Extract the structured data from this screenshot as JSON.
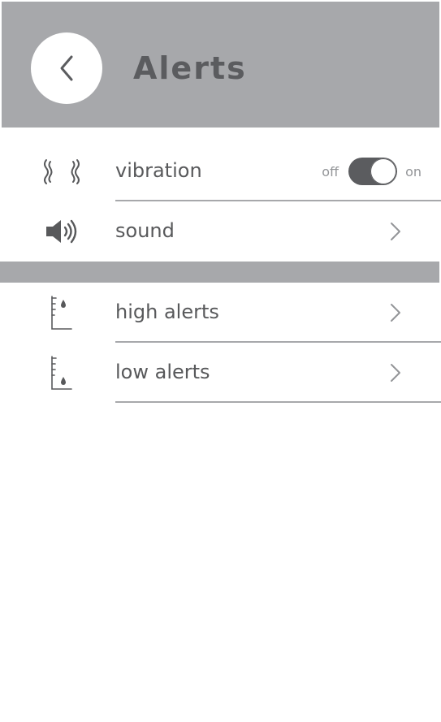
{
  "header": {
    "title": "Alerts",
    "back_icon": "chevron-left-icon",
    "background_color": "#a7a8ab"
  },
  "settings": {
    "vibration": {
      "label": "vibration",
      "icon": "vibration-icon",
      "toggle_off_label": "off",
      "toggle_on_label": "on",
      "toggle_state": "on"
    },
    "sound": {
      "label": "sound",
      "icon": "speaker-icon"
    }
  },
  "alerts": {
    "high": {
      "label": "high alerts",
      "icon": "high-level-drop-icon"
    },
    "low": {
      "label": "low alerts",
      "icon": "low-level-drop-icon"
    }
  },
  "colors": {
    "accent_gray": "#a7a8ab",
    "text_gray": "#58595b",
    "toggle_track": "#5b5c5f"
  }
}
